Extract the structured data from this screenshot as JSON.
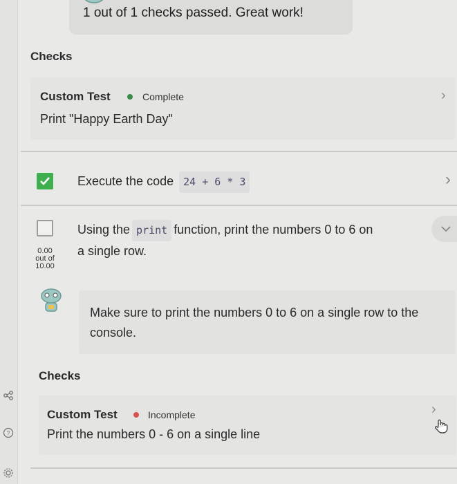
{
  "banner": {
    "text": "1 out of 1 checks passed. Great work!"
  },
  "checks_top": {
    "label": "Checks",
    "test": {
      "title": "Custom Test",
      "status": "Complete",
      "status_color": "#3b8a4a",
      "description": "Print \"Happy Earth Day\""
    }
  },
  "step1": {
    "text": "Execute the code",
    "code": "24 + 6 * 3",
    "checked": true
  },
  "step2": {
    "text_before": "Using the",
    "code": "print",
    "text_after": "function, print the numbers 0 to 6 on",
    "text_line2": "a single row.",
    "score": {
      "value": "0.00",
      "out_of_label": "out of",
      "total": "10.00"
    },
    "checked": false
  },
  "hint": {
    "text": "Make sure to print the numbers 0 to 6 on a single row to the console."
  },
  "checks_bottom": {
    "label": "Checks",
    "test": {
      "title": "Custom Test",
      "status": "Incomplete",
      "status_color": "#d9534f",
      "description": "Print the numbers 0 - 6 on a single line"
    }
  },
  "icons": {
    "share": "share-icon",
    "help": "help-icon",
    "settings": "settings-icon",
    "chevron": "chevron-right-icon",
    "hand": "hand-pointer-icon"
  }
}
